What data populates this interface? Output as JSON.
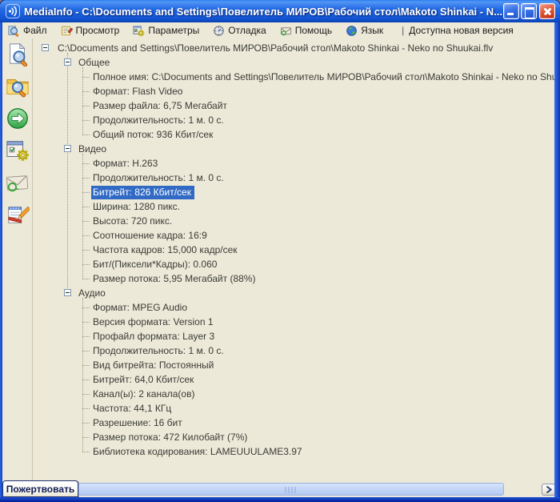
{
  "window": {
    "title": "MediaInfo - C:\\Documents and Settings\\Повелитель МИРОВ\\Рабочий стол\\Makoto Shinkai - N...",
    "controls": [
      {
        "name": "minimize",
        "icon": "minimize-icon"
      },
      {
        "name": "maximize",
        "icon": "maximize-icon"
      },
      {
        "name": "close",
        "icon": "close-icon"
      }
    ]
  },
  "menu": {
    "items": [
      {
        "label": "Файл",
        "icon": "file-search-icon"
      },
      {
        "label": "Просмотр",
        "icon": "view-icon"
      },
      {
        "label": "Параметры",
        "icon": "options-gear-icon"
      },
      {
        "label": "Отладка",
        "icon": "debug-gauge-icon"
      },
      {
        "label": "Помощь",
        "icon": "help-mail-icon"
      },
      {
        "label": "Язык",
        "icon": "language-globe-icon"
      }
    ],
    "update_separator": "|",
    "update_notice": "Доступна новая версия"
  },
  "toolbar": {
    "buttons": [
      {
        "name": "open-file",
        "icon": "open-file-icon"
      },
      {
        "name": "open-folder",
        "icon": "open-folder-icon"
      },
      {
        "name": "go-export",
        "icon": "green-arrow-icon"
      },
      {
        "name": "options",
        "icon": "options-window-gear-icon"
      },
      {
        "name": "mail-about",
        "icon": "envelope-at-icon"
      },
      {
        "name": "notes-edit",
        "icon": "notepad-pencil-icon"
      }
    ]
  },
  "tree": {
    "rows": [
      {
        "level": 0,
        "expander": true,
        "selected": false,
        "label": "C:\\Documents and Settings\\Повелитель МИРОВ\\Рабочий стол\\Makoto Shinkai - Neko no Shuukai.flv"
      },
      {
        "level": 1,
        "expander": true,
        "selected": false,
        "label": "Общее"
      },
      {
        "level": 2,
        "expander": false,
        "selected": false,
        "label": "Полное имя: C:\\Documents and Settings\\Повелитель МИРОВ\\Рабочий стол\\Makoto Shinkai - Neko no Shuukai.flv"
      },
      {
        "level": 2,
        "expander": false,
        "selected": false,
        "label": "Формат: Flash Video"
      },
      {
        "level": 2,
        "expander": false,
        "selected": false,
        "label": "Размер файла: 6,75 Мегабайт"
      },
      {
        "level": 2,
        "expander": false,
        "selected": false,
        "label": "Продолжительность: 1 м. 0 с."
      },
      {
        "level": 2,
        "expander": false,
        "selected": false,
        "label": "Общий поток: 936 Кбит/сек"
      },
      {
        "level": 1,
        "expander": true,
        "selected": false,
        "label": "Видео"
      },
      {
        "level": 2,
        "expander": false,
        "selected": false,
        "label": "Формат: H.263"
      },
      {
        "level": 2,
        "expander": false,
        "selected": false,
        "label": "Продолжительность: 1 м. 0 с."
      },
      {
        "level": 2,
        "expander": false,
        "selected": true,
        "label": "Битрейт: 826 Кбит/сек"
      },
      {
        "level": 2,
        "expander": false,
        "selected": false,
        "label": "Ширина: 1280 пикс."
      },
      {
        "level": 2,
        "expander": false,
        "selected": false,
        "label": "Высота: 720 пикс."
      },
      {
        "level": 2,
        "expander": false,
        "selected": false,
        "label": "Соотношение кадра: 16:9"
      },
      {
        "level": 2,
        "expander": false,
        "selected": false,
        "label": "Частота кадров: 15,000 кадр/сек"
      },
      {
        "level": 2,
        "expander": false,
        "selected": false,
        "label": "Бит/(Пиксели*Кадры): 0.060"
      },
      {
        "level": 2,
        "expander": false,
        "selected": false,
        "label": "Размер потока: 5,95 Мегабайт (88%)"
      },
      {
        "level": 1,
        "expander": true,
        "selected": false,
        "label": "Аудио"
      },
      {
        "level": 2,
        "expander": false,
        "selected": false,
        "label": "Формат: MPEG Audio"
      },
      {
        "level": 2,
        "expander": false,
        "selected": false,
        "label": "Версия формата: Version 1"
      },
      {
        "level": 2,
        "expander": false,
        "selected": false,
        "label": "Профайл формата: Layer 3"
      },
      {
        "level": 2,
        "expander": false,
        "selected": false,
        "label": "Продолжительность: 1 м. 0 с."
      },
      {
        "level": 2,
        "expander": false,
        "selected": false,
        "label": "Вид битрейта: Постоянный"
      },
      {
        "level": 2,
        "expander": false,
        "selected": false,
        "label": "Битрейт: 64,0 Кбит/сек"
      },
      {
        "level": 2,
        "expander": false,
        "selected": false,
        "label": "Канал(ы): 2 канала(ов)"
      },
      {
        "level": 2,
        "expander": false,
        "selected": false,
        "label": "Частота: 44,1 КГц"
      },
      {
        "level": 2,
        "expander": false,
        "selected": false,
        "label": "Разрешение: 16 бит"
      },
      {
        "level": 2,
        "expander": false,
        "selected": false,
        "label": "Размер потока: 472 Килобайт (7%)"
      },
      {
        "level": 2,
        "expander": false,
        "selected": false,
        "label": "Библиотека кодирования: LAMEUUULAME3.97"
      }
    ]
  },
  "bottom": {
    "donate_label": "Пожертвовать",
    "scrollbar": {
      "orientation": "horizontal",
      "arrow": "right"
    }
  },
  "colors": {
    "titlebar_blue": "#1557d6",
    "selection_blue": "#316ac5",
    "face_beige": "#ece9d8",
    "frame_blue": "#1446c8",
    "close_red": "#bc2a0c"
  }
}
